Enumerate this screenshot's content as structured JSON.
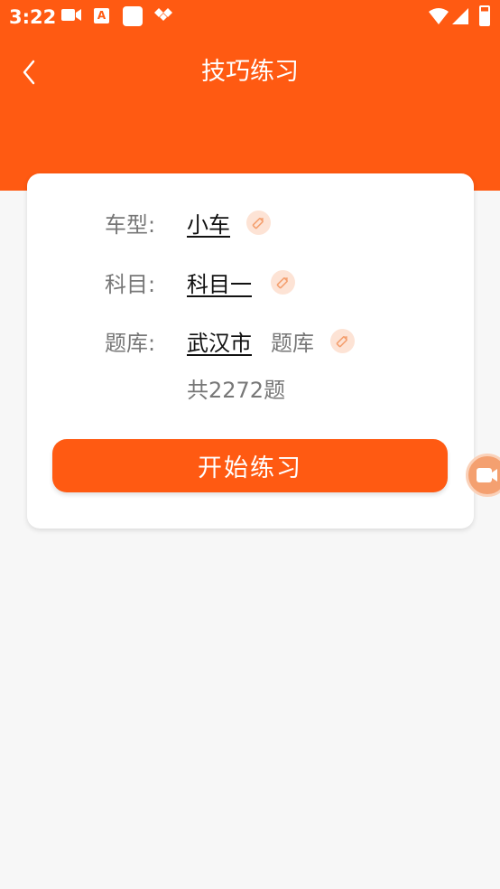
{
  "status_bar": {
    "time": "3:22",
    "icons": [
      "video-icon",
      "a-letter-icon",
      "square-icon",
      "diamonds-icon",
      "wifi-icon",
      "signal-icon",
      "battery-icon"
    ],
    "a_letter": "A"
  },
  "header": {
    "title": "技巧练习",
    "back_icon": "chevron-left-icon"
  },
  "form": {
    "car_type": {
      "label": "车型:",
      "value": "小车",
      "edit_icon": "pencil-icon"
    },
    "subject": {
      "label": "科目:",
      "value": "科目一",
      "edit_icon": "pencil-icon"
    },
    "bank": {
      "label": "题库:",
      "value": "武汉市",
      "suffix": "题库",
      "edit_icon": "pencil-icon"
    },
    "count": "共2272题"
  },
  "start_button": {
    "label": "开始练习"
  },
  "floating_button": {
    "icon": "camera-icon"
  },
  "colors": {
    "accent": "#ff5a12",
    "edit_bg": "#fde3d5",
    "edit_icon": "#f4a070",
    "page_bg": "#f7f7f7"
  }
}
